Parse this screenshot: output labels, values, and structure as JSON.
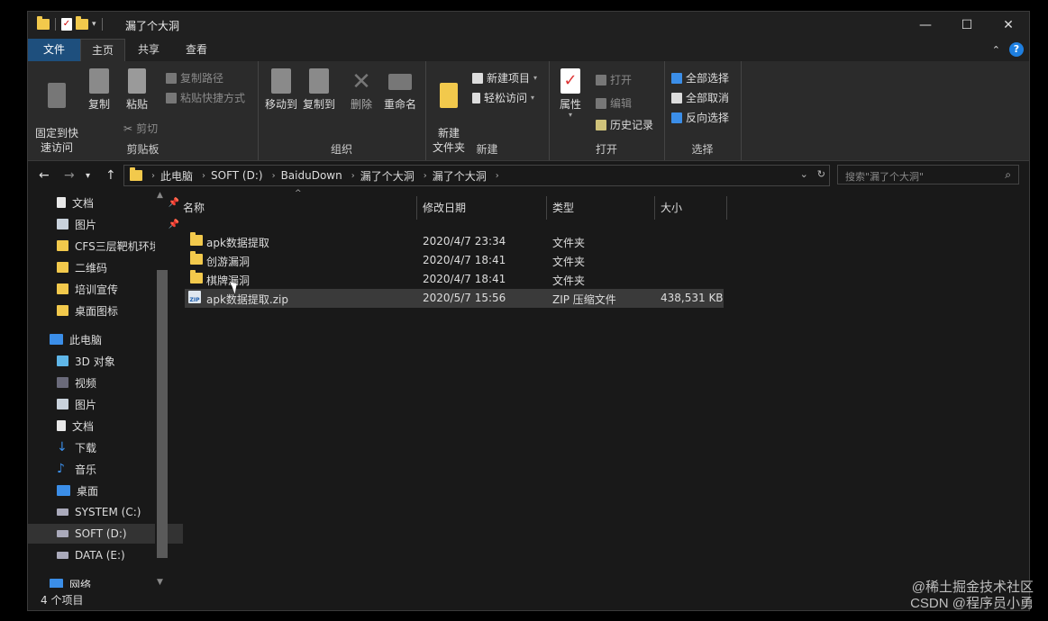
{
  "window": {
    "title": "漏了个大洞",
    "controls": {
      "minimize": "—",
      "maximize": "☐",
      "close": "✕"
    }
  },
  "ribbon_tabs": [
    {
      "label": "文件"
    },
    {
      "label": "主页"
    },
    {
      "label": "共享"
    },
    {
      "label": "查看"
    }
  ],
  "ribbon": {
    "clipboard": {
      "label": "剪贴板",
      "pin": "固定到快\n速访问",
      "copy": "复制",
      "paste": "粘贴",
      "copy_path": "复制路径",
      "paste_shortcut": "粘贴快捷方式",
      "cut": "剪切"
    },
    "organize": {
      "label": "组织",
      "move_to": "移动到",
      "copy_to": "复制到",
      "delete": "删除",
      "rename": "重命名"
    },
    "new": {
      "label": "新建",
      "new_folder": "新建\n文件夹",
      "new_item": "新建项目",
      "easy_access": "轻松访问"
    },
    "open": {
      "label": "打开",
      "properties": "属性",
      "open": "打开",
      "edit": "编辑",
      "history": "历史记录"
    },
    "select": {
      "label": "选择",
      "select_all": "全部选择",
      "select_none": "全部取消",
      "invert": "反向选择"
    }
  },
  "address": {
    "crumbs": [
      "此电脑",
      "SOFT (D:)",
      "BaiduDown",
      "漏了个大洞",
      "漏了个大洞"
    ],
    "search_placeholder": "搜索\"漏了个大洞\""
  },
  "nav_pane": {
    "quick_access": [
      {
        "label": "文档",
        "pinned": true
      },
      {
        "label": "图片",
        "pinned": true
      },
      {
        "label": "CFS三层靶机环境"
      },
      {
        "label": "二维码"
      },
      {
        "label": "培训宣传"
      },
      {
        "label": "桌面图标"
      }
    ],
    "this_pc": "此电脑",
    "pc_items": [
      {
        "label": "3D 对象"
      },
      {
        "label": "视频"
      },
      {
        "label": "图片"
      },
      {
        "label": "文档"
      },
      {
        "label": "下载"
      },
      {
        "label": "音乐"
      },
      {
        "label": "桌面"
      },
      {
        "label": "SYSTEM (C:)"
      },
      {
        "label": "SOFT (D:)"
      },
      {
        "label": "DATA (E:)"
      }
    ],
    "network": "网络"
  },
  "columns": {
    "name": "名称",
    "modified": "修改日期",
    "type": "类型",
    "size": "大小"
  },
  "files": [
    {
      "name": "apk数据提取",
      "modified": "2020/4/7 23:34",
      "type": "文件夹",
      "size": ""
    },
    {
      "name": "创游漏洞",
      "modified": "2020/4/7 18:41",
      "type": "文件夹",
      "size": ""
    },
    {
      "name": "棋牌漏洞",
      "modified": "2020/4/7 18:41",
      "type": "文件夹",
      "size": ""
    },
    {
      "name": "apk数据提取.zip",
      "modified": "2020/5/7 15:56",
      "type": "ZIP 压缩文件",
      "size": "438,531 KB"
    }
  ],
  "status": {
    "count": "4 个项目"
  },
  "watermark": {
    "line1": "@稀土掘金技术社区",
    "line2": "CSDN @程序员小勇"
  }
}
